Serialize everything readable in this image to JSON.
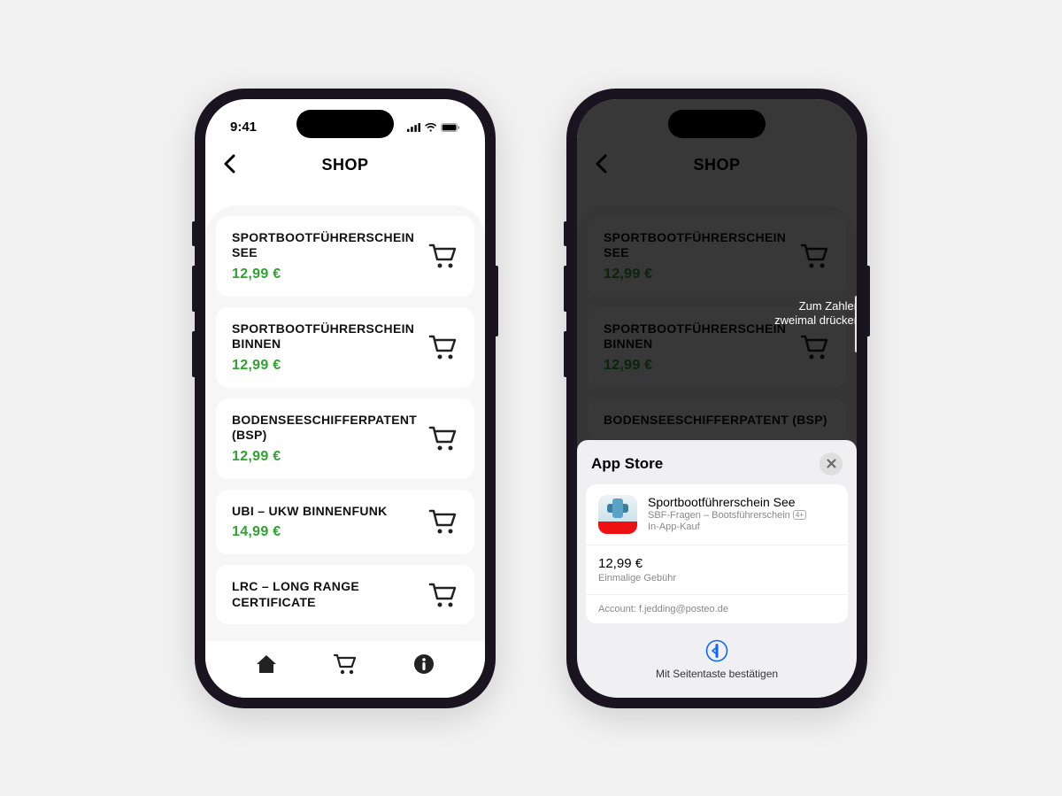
{
  "status": {
    "time": "9:41"
  },
  "header": {
    "title": "SHOP"
  },
  "shop_items": [
    {
      "title": "SPORTBOOTFÜHRERSCHEIN SEE",
      "price": "12,99 €"
    },
    {
      "title": "SPORTBOOTFÜHRERSCHEIN BINNEN",
      "price": "12,99 €"
    },
    {
      "title": "BODENSEESCHIFFERPATENT (BSP)",
      "price": "12,99 €"
    },
    {
      "title": "UBI – UKW BINNENFUNK",
      "price": "14,99 €"
    },
    {
      "title": "LRC – LONG RANGE CERTIFICATE",
      "price": ""
    }
  ],
  "side_hint": {
    "line1": "Zum Zahlen",
    "line2": "zweimal drücken"
  },
  "sheet": {
    "header": "App Store",
    "item_title": "Sportbootführerschein See",
    "item_sub": "SBF-Fragen – Bootsführerschein",
    "age_rating": "4+",
    "item_type": "In-App-Kauf",
    "price": "12,99 €",
    "price_sub": "Einmalige Gebühr",
    "account_label": "Account: f.jedding@posteo.de",
    "confirm": "Mit Seitentaste bestätigen"
  }
}
